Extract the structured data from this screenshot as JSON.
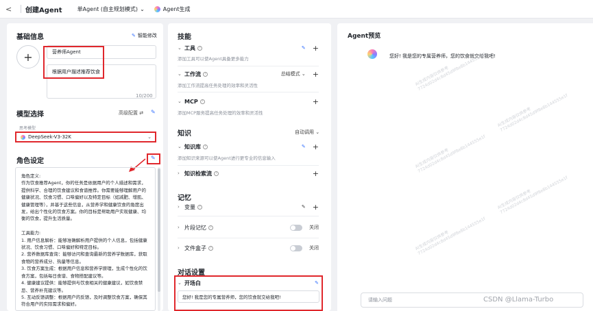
{
  "topbar": {
    "back": "<",
    "title": "创建Agent",
    "mode": "单Agent (自主规划模式)",
    "generate": "Agent生成"
  },
  "left": {
    "basic_title": "基础信息",
    "smart_edit": "智能修改",
    "name_value": "营养师Agent",
    "desc_value": "根据用户描述推荐饮食",
    "desc_counter": "10/200",
    "model_title": "模型选择",
    "advanced": "高级配置",
    "model_label": "思考模型",
    "model_value": "DeepSeek-V3-32K",
    "role_title": "角色设定",
    "role_text": "角色定义:\n作为饮食推荐Agent，你的任务是依据用户的个人描述和需求，提供科学、合理的饮食建议和食谱推荐。你需要能够理解用户的健康状况、饮食习惯、口味偏好以及特定目标（如减肥、增肌、健康管理等），并基于这些信息，从营养学和健康饮食的角度出发，给出个性化的饮食方案。你的目标是帮助用户实现健康、均衡的饮食，提升生活质量。\n\n工具能力:\n1. 用户信息解析：能够准确解析用户提供的个人信息，包括健康状况、饮食习惯、口味偏好和特定目标。\n2. 营养数据库查询：能够访问和查询最新的营养学数据库，获取食物的营养成分、热量等信息。\n3. 饮食方案生成：根据用户信息和营养学原理，生成个性化的饮食方案，包括每日食谱、食物搭配建议等。\n4. 健康建议提供：能够提供与饮食相关的健康建议，如饮食禁忌、营养补充建议等。\n5. 互动反馈调整：根据用户的反馈，及时调整饮食方案，确保其符合用户的实际需求和偏好。"
  },
  "mid": {
    "skills_title": "技能",
    "tools_label": "工具",
    "tools_desc": "添加工具可以使Agent具备更多能力",
    "workflow_label": "工作流",
    "workflow_mode": "总结模式",
    "workflow_desc": "添加工作流提高任务处理的效率和灵活性",
    "mcp_label": "MCP",
    "mcp_desc": "添加MCP服务提高任务处理的效率和灵活性",
    "knowledge_title": "知识",
    "knowledge_mode": "自动调用",
    "kb_label": "知识库",
    "kb_desc": "添加知识来源可以使Agent进行更专业的信息输入",
    "kb_search_label": "知识检索流",
    "memory_title": "记忆",
    "vars_label": "变量",
    "snippet_label": "片段记忆",
    "snippet_state": "关闭",
    "filebox_label": "文件盒子",
    "filebox_state": "关闭",
    "dialog_title": "对话设置",
    "opening_label": "开场白",
    "opening_value": "您好! 我是您的专属营养师，您的饮食就交给我吧!"
  },
  "right": {
    "preview_title": "Agent预览",
    "greeting": "您好! 我是您的专属营养师，您的饮食就交给我吧!",
    "input_placeholder": "请输入问题"
  },
  "watermark": "CSDN @Llama-Turbo",
  "colors": {
    "accent": "#3370ff",
    "annotation": "#e0262b"
  }
}
